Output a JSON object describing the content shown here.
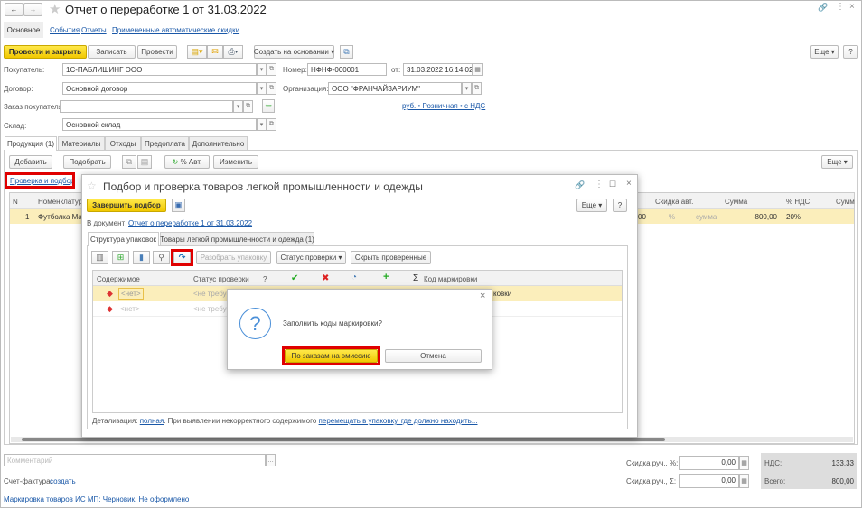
{
  "window": {
    "title": "Отчет о переработке 1 от 31.03.2022"
  },
  "nav": {
    "back": "←",
    "forward": "→"
  },
  "section_tabs": [
    "Основное",
    "События",
    "Отчеты",
    "Примененные автоматические скидки"
  ],
  "toolbar": {
    "post_close": "Провести и закрыть",
    "save": "Записать",
    "post": "Провести",
    "create_based": "Создать на основании",
    "more": "Еще",
    "help": "?"
  },
  "fields": {
    "buyer_label": "Покупатель:",
    "buyer": "1С-ПАБЛИШИНГ ООО",
    "number_label": "Номер:",
    "number": "НФНФ-000001",
    "date_label": "от:",
    "date": "31.03.2022 16:14:02",
    "contract_label": "Договор:",
    "contract": "Основной договор",
    "org_label": "Организация:",
    "org": "ООО \"ФРАНЧАЙЗАРИУМ\"",
    "order_label": "Заказ покупателя:",
    "order": "",
    "price_link": "руб. • Розничная • с НДС",
    "warehouse_label": "Склад:",
    "warehouse": "Основной склад"
  },
  "doc_tabs": [
    "Продукция (1)",
    "Материалы",
    "Отходы",
    "Предоплата",
    "Дополнительно"
  ],
  "table_toolbar": {
    "add": "Добавить",
    "pick": "Подобрать",
    "auto_pct": "% Авт.",
    "change": "Изменить",
    "more": "Еще"
  },
  "check_link": "Проверка и подбор",
  "table": {
    "headers": {
      "n": "N",
      "nom": "Номенклатура",
      "disc_auto": "Скидка авт.",
      "sum": "Сумма",
      "vat": "% НДС",
      "sum_vat": "Сумм"
    },
    "rows": [
      {
        "n": "1",
        "nom": "Футболка Ма",
        "qty_tail": "00",
        "pct": "%",
        "sum_ph": "сумма",
        "sum": "800,00",
        "vat": "20%"
      }
    ]
  },
  "footer": {
    "comment_placeholder": "Комментарий",
    "invoice_label": "Счет-фактура:",
    "invoice_link": "создать",
    "marking_link": "Маркировка товаров ИС МП: Черновик. Не оформлено",
    "disc_pct_label": "Скидка руч., %:",
    "disc_pct": "0,00",
    "disc_sum_label": "Скидка руч., Σ:",
    "disc_sum": "0,00",
    "vat_label": "НДС:",
    "vat": "133,33",
    "total_label": "Всего:",
    "total": "800,00"
  },
  "modal": {
    "title": "Подбор и проверка товаров легкой промышленности и одежды",
    "finish": "Завершить подбор",
    "more": "Еще",
    "help": "?",
    "doc_label": "В документ:",
    "doc_link": "Отчет о переработке 1 от 31.03.2022",
    "tabs": [
      "Структура упаковок",
      "Товары легкой промышленности и одежда (1)"
    ],
    "unpack": "Разобрать упаковку",
    "status": "Статус проверки",
    "hide_checked": "Скрыть проверенные",
    "grid_headers": {
      "content": "Содержимое",
      "status": "Статус проверки",
      "q": "?",
      "code": "Код маркировки"
    },
    "rows": [
      {
        "content": "<нет>",
        "status": "<не требуе",
        "code": "ковки"
      },
      {
        "content": "<нет>",
        "status": "<не требуе"
      }
    ],
    "detail_label": "Детализация:",
    "detail_link": "полная",
    "detail_text": ". При выявлении некорректного содержимого",
    "move_link": "перемещать в упаковку, где должно находить..."
  },
  "dialog": {
    "question": "Заполнить коды маркировки?",
    "by_orders": "По заказам на эмиссию",
    "cancel": "Отмена"
  }
}
